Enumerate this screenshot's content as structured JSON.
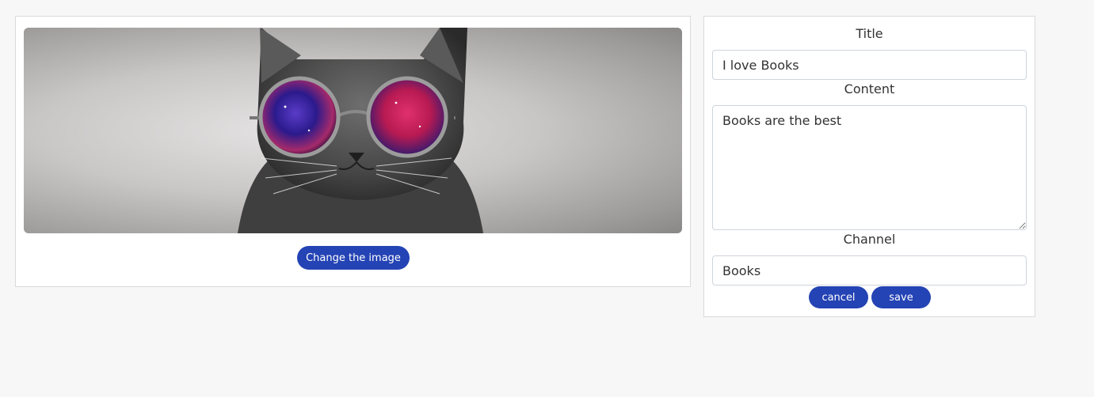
{
  "image_panel": {
    "image_subject": "cat wearing round galaxy sunglasses",
    "change_button_label": "Change the image"
  },
  "form": {
    "title_label": "Title",
    "title_value": "I love Books",
    "content_label": "Content",
    "content_value": "Books are the best",
    "channel_label": "Channel",
    "channel_value": "Books",
    "cancel_label": "cancel",
    "save_label": "save"
  },
  "colors": {
    "accent": "#2443b4",
    "page_background": "#f7f7f7",
    "card_border": "#dadada"
  }
}
